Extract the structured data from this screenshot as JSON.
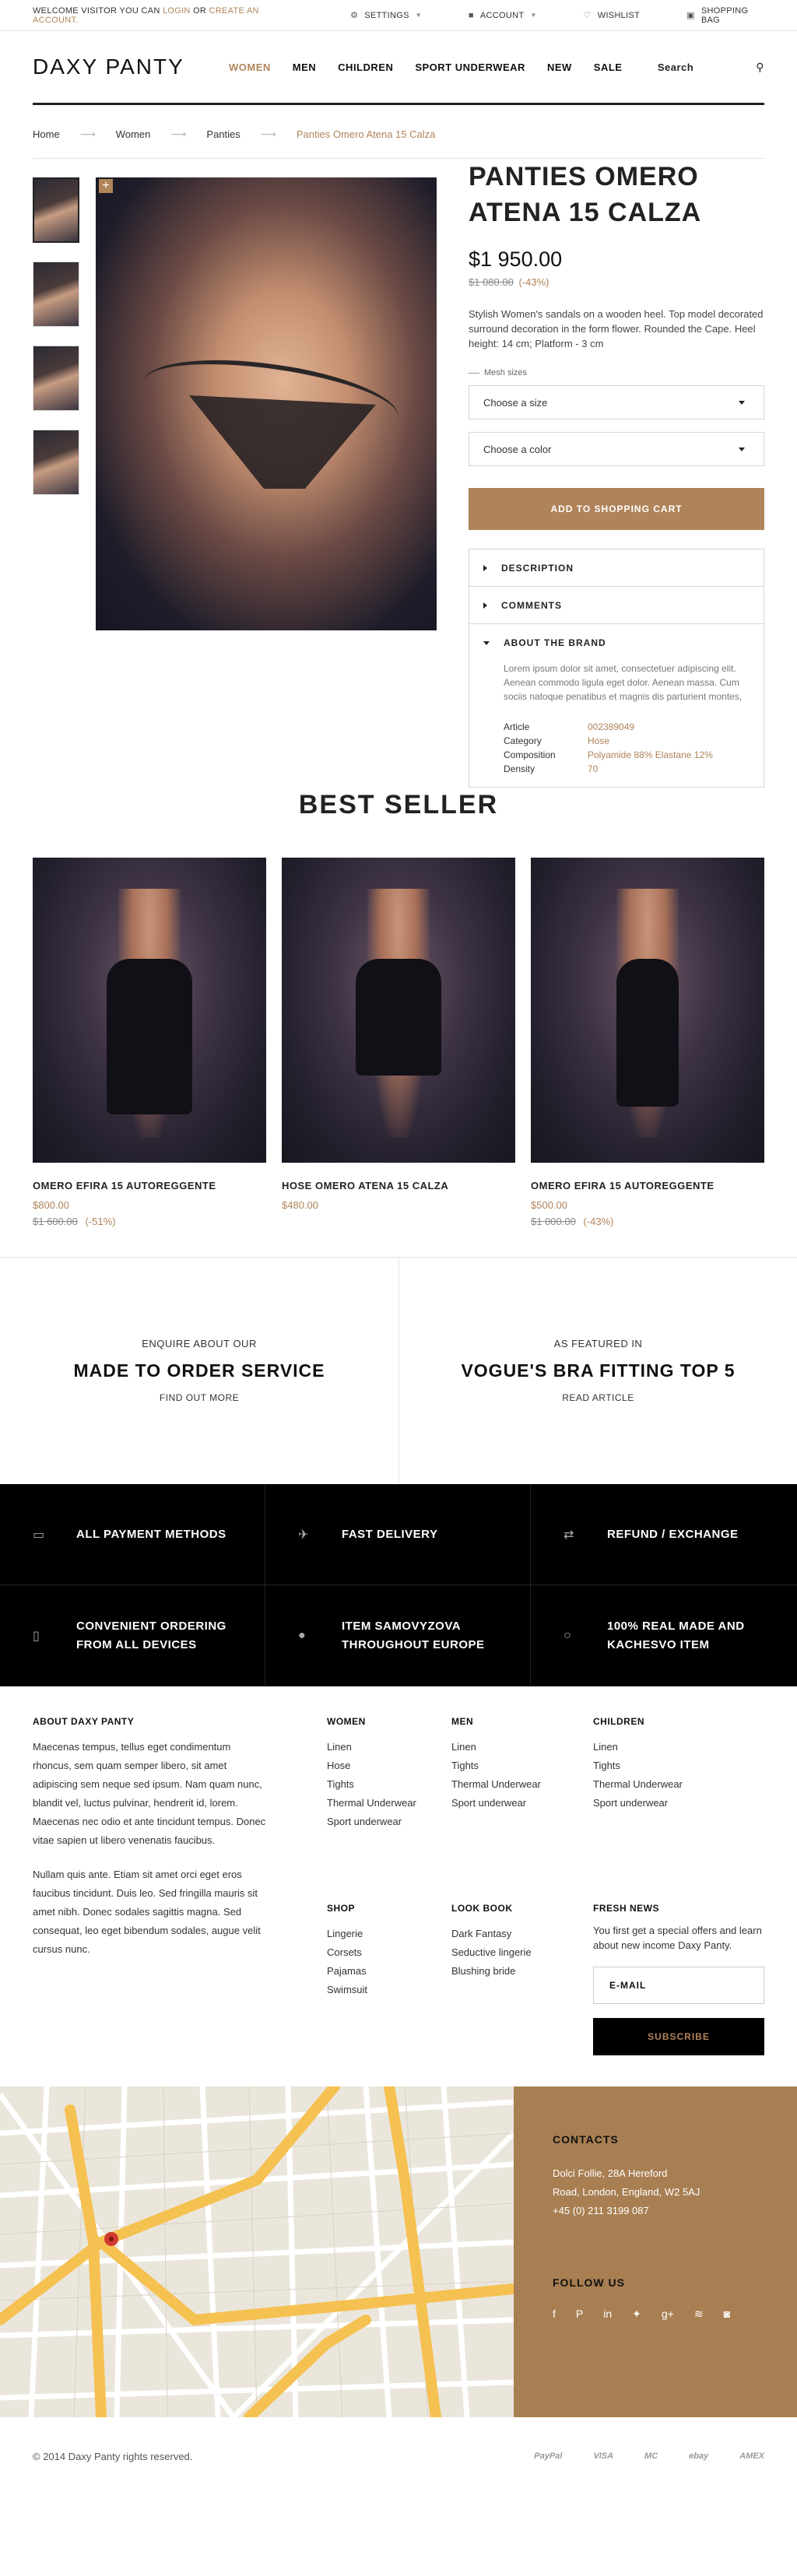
{
  "topbar": {
    "welcome": "Welcome visitor you can",
    "login": "login",
    "or": "or",
    "create": "create an account.",
    "settings": "Settings",
    "account": "Account",
    "wishlist": "Wishlist",
    "bag": "Shopping bag"
  },
  "header": {
    "logo": "DAXY PANTY",
    "nav": [
      "Women",
      "Men",
      "Children",
      "Sport Underwear",
      "New",
      "Sale"
    ],
    "search": "Search"
  },
  "breadcrumb": [
    "Home",
    "Women",
    "Panties",
    "Panties Omero Atena 15 Calza"
  ],
  "product": {
    "title": "Panties Omero Atena 15 Calza",
    "price": "$1 950.00",
    "old_price": "$1 080.00",
    "discount": "(-43%)",
    "description": "Stylish Women's sandals on a wooden heel. Top model decorated surround decoration in the form flower. Rounded the Cape. Heel height: 14 cm; Platform - 3 cm",
    "mesh_label": "Mesh sizes",
    "size_select": "Choose a size",
    "color_select": "Choose a color",
    "add_to_cart": "Add to shopping cart",
    "tabs": [
      "Description",
      "Comments",
      "About the brand"
    ],
    "brand_text": "Lorem ipsum dolor sit amet, consectetuer adipiscing elit. Aenean commodo ligula eget dolor. Aenean massa. Cum sociis natoque penatibus et magnis dis parturient montes,",
    "specs": [
      {
        "k": "Article",
        "v": "002389049"
      },
      {
        "k": "Category",
        "v": "Hose"
      },
      {
        "k": "Composition",
        "v": "Polyamide 88% Elastane 12%"
      },
      {
        "k": "Density",
        "v": "70"
      }
    ]
  },
  "best_seller": {
    "title": "Best Seller",
    "items": [
      {
        "name": "Omero Efira 15 Autoreggente",
        "price": "$800.00",
        "old": "$1 600.00",
        "disc": "(-51%)"
      },
      {
        "name": "Hose Omero Atena 15 Calza",
        "price": "$480.00",
        "old": "",
        "disc": ""
      },
      {
        "name": "Omero Efira 15 Autoreggente",
        "price": "$500.00",
        "old": "$1 000.00",
        "disc": "(-43%)"
      }
    ]
  },
  "promo": [
    {
      "small": "Enquire about our",
      "big": "Made to order service",
      "link": "Find out more"
    },
    {
      "small": "As featured in",
      "big": "Vogue's bra fitting top 5",
      "link": "Read article"
    }
  ],
  "features": [
    {
      "icon": "card-icon",
      "glyph": "▭",
      "text": "All payment methods"
    },
    {
      "icon": "plane-icon",
      "glyph": "✈",
      "text": "Fast delivery"
    },
    {
      "icon": "exchange-icon",
      "glyph": "⇄",
      "text": "Refund / exchange"
    },
    {
      "icon": "phone-icon",
      "glyph": "▯",
      "text": "Convenient ordering from all devices"
    },
    {
      "icon": "pin-icon",
      "glyph": "●",
      "text": "Item samovyzova throughout Europe"
    },
    {
      "icon": "circle-icon",
      "glyph": "○",
      "text": "100% real made and kachesvo item"
    }
  ],
  "footer": {
    "about_title": "About Daxy Panty",
    "about_p1": "Maecenas tempus, tellus eget condimentum rhoncus, sem quam semper libero, sit amet adipiscing sem neque sed ipsum. Nam quam nunc, blandit vel, luctus pulvinar, hendrerit id, lorem. Maecenas nec odio et ante tincidunt tempus. Donec vitae sapien ut libero venenatis faucibus.",
    "about_p2": "Nullam quis ante. Etiam sit amet orci eget eros faucibus tincidunt. Duis leo. Sed fringilla mauris sit amet nibh. Donec sodales sagittis magna. Sed consequat, leo eget bibendum sodales, augue velit cursus nunc.",
    "women": {
      "title": "Women",
      "items": [
        "Linen",
        "Hose",
        "Tights",
        "Thermal Underwear",
        "Sport underwear"
      ]
    },
    "men": {
      "title": "Men",
      "items": [
        "Linen",
        "Tights",
        "Thermal Underwear",
        "Sport underwear"
      ]
    },
    "children": {
      "title": "Children",
      "items": [
        "Linen",
        "Tights",
        "Thermal Underwear",
        "Sport underwear"
      ]
    },
    "shop": {
      "title": "Shop",
      "items": [
        "Lingerie",
        "Corsets",
        "Pajamas",
        "Swimsuit"
      ]
    },
    "lookbook": {
      "title": "Look book",
      "items": [
        "Dark Fantasy",
        "Seductive lingerie",
        "Blushing bride"
      ]
    },
    "news_title": "Fresh news",
    "news_text": "You first get a special offers and learn about new income Daxy Panty.",
    "email_placeholder": "E-mail",
    "subscribe": "Subscribe"
  },
  "contacts": {
    "title": "Contacts",
    "line1": "Dolci Follie, 28A Hereford",
    "line2": "Road, London, England, W2 5AJ",
    "line3": "+45 (0) 211 3199 087",
    "follow": "Follow us"
  },
  "bottom": {
    "copyright": "© 2014 Daxy Panty rights reserved.",
    "payments": [
      "PayPal",
      "VISA",
      "MC",
      "ebay",
      "AMEX"
    ]
  },
  "colors": {
    "accent": "#b0845a",
    "contacts_bg": "#a87f52",
    "dark": "#000000"
  }
}
